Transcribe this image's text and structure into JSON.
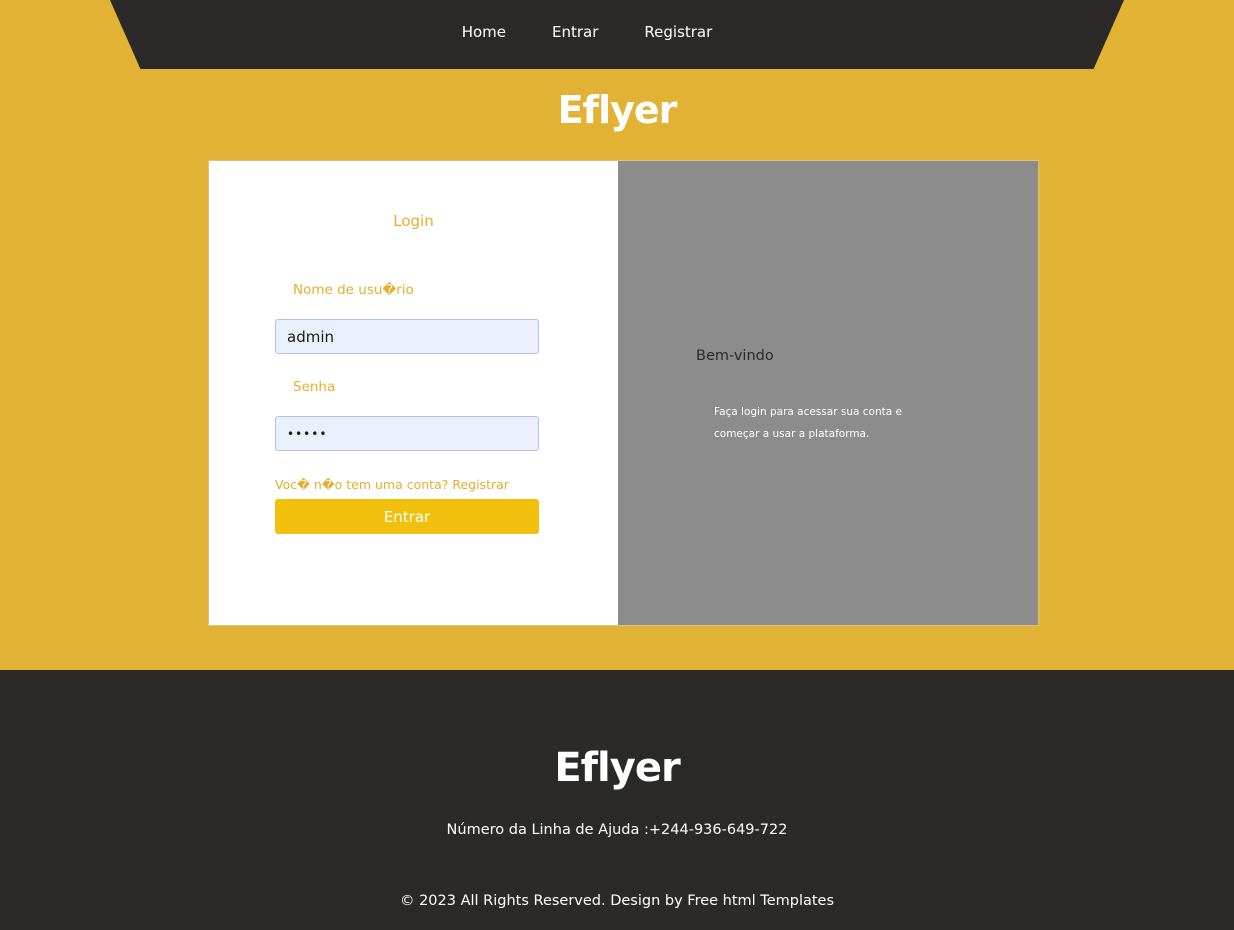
{
  "nav": {
    "items": [
      {
        "label": "Home"
      },
      {
        "label": "Entrar"
      },
      {
        "label": "Registrar"
      }
    ]
  },
  "brand": "Eflyer",
  "login": {
    "title": "Login",
    "username_label": "Nome de usu�rio",
    "username_value": "admin",
    "password_label": "Senha",
    "password_value": "admin",
    "register_text": "Voc� n�o tem uma conta? Registrar",
    "submit_label": "Entrar"
  },
  "welcome": {
    "title": "Bem-vindo",
    "text": "Faça login para acessar sua conta e começar a usar a plataforma."
  },
  "footer": {
    "brand": "Eflyer",
    "helpline": "Número da Linha de Ajuda :+244-936-649-722",
    "copyright": "© 2023 All Rights Reserved. Design by Free html Templates"
  },
  "colors": {
    "background": "#e2b235",
    "dark": "#2b2a29",
    "accent_text": "#e5ae2c",
    "button": "#f0c00c",
    "panel_gray": "#8c8c8c"
  }
}
